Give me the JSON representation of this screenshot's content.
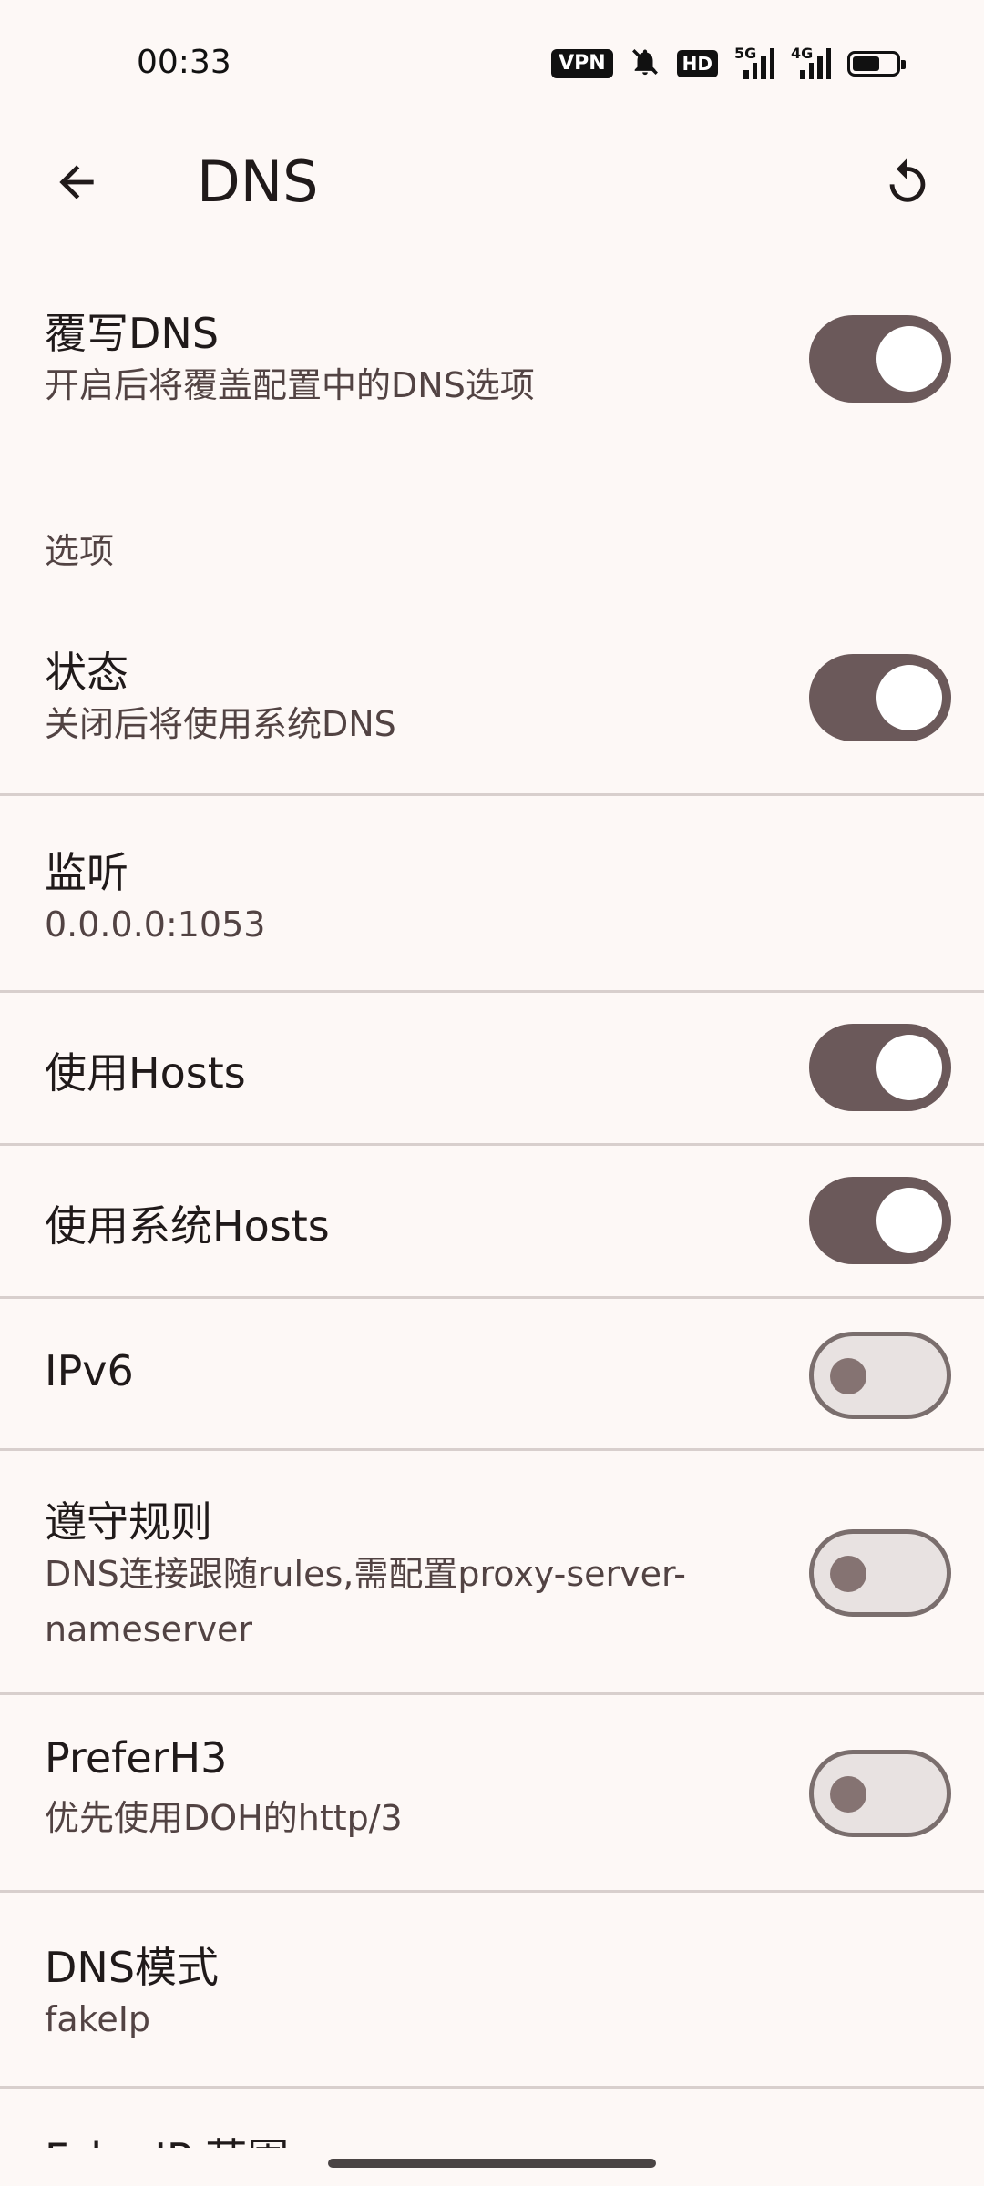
{
  "status_bar": {
    "time": "00:33",
    "vpn_label": "VPN",
    "hd_label": "HD",
    "signal1_label": "5G",
    "signal2_label": "4G",
    "battery_level": 0.55
  },
  "app_bar": {
    "title": "DNS",
    "back_icon": "arrow-back-icon",
    "reset_icon": "refresh-icon"
  },
  "override": {
    "title": "覆写DNS",
    "subtitle": "开启后将覆盖配置中的DNS选项",
    "enabled": true
  },
  "section_label": "选项",
  "options": {
    "status": {
      "title": "状态",
      "subtitle": "关闭后将使用系统DNS",
      "enabled": true
    },
    "listen": {
      "title": "监听",
      "value": "0.0.0.0:1053"
    },
    "use_hosts": {
      "title": "使用Hosts",
      "enabled": true
    },
    "use_system_hosts": {
      "title": "使用系统Hosts",
      "enabled": true
    },
    "ipv6": {
      "title": "IPv6",
      "enabled": false
    },
    "follow_rules": {
      "title": "遵守规则",
      "subtitle_line1": "DNS连接跟随rules,需配置proxy-server-",
      "subtitle_line2": "nameserver",
      "enabled": false
    },
    "prefer_h3": {
      "title": "PreferH3",
      "subtitle": "优先使用DOH的http/3",
      "enabled": false
    },
    "dns_mode": {
      "title": "DNS模式",
      "value": "fakeIp"
    },
    "next_partial": {
      "title": "Fake-IP 范围"
    }
  },
  "colors": {
    "background": "#fdf8f6",
    "switch_on_track": "#6b595a",
    "switch_off_track": "#e8e2e1",
    "divider": "#d8cfcd"
  }
}
